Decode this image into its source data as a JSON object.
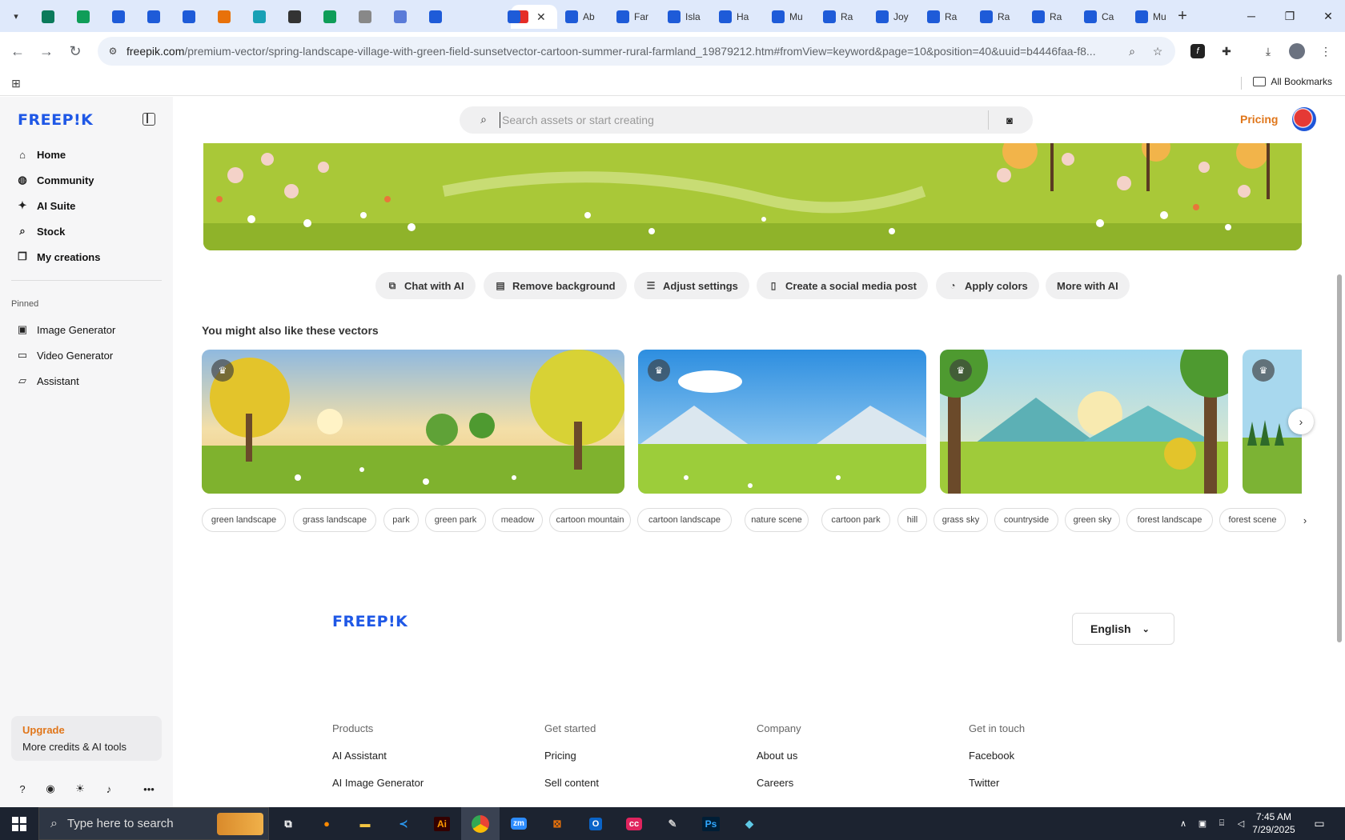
{
  "browser": {
    "tabs": [
      {
        "label": "",
        "color": "#0b7a5a"
      },
      {
        "label": "",
        "color": "#0f9d58"
      },
      {
        "label": "",
        "color": "#1e5bd8"
      },
      {
        "label": "",
        "color": "#1e5bd8"
      },
      {
        "label": "",
        "color": "#1e5bd8"
      },
      {
        "label": "",
        "color": "#e8710a"
      },
      {
        "label": "",
        "color": "#18a0b5"
      },
      {
        "label": "",
        "color": "#333333"
      },
      {
        "label": "",
        "color": "#0f9d58"
      },
      {
        "label": "",
        "color": "#888888"
      },
      {
        "label": "",
        "color": "#5a7bd8"
      },
      {
        "label": "",
        "color": "#1e5bd8"
      },
      {
        "label": "",
        "color": "#e52d27"
      },
      {
        "label": "",
        "color": "#1e5bd8"
      },
      {
        "label": "Ab",
        "color": "#1e5bd8"
      },
      {
        "label": "Far",
        "color": "#1e5bd8"
      },
      {
        "label": "Isla",
        "color": "#1e5bd8"
      },
      {
        "label": "Ha",
        "color": "#1e5bd8"
      },
      {
        "label": "Mu",
        "color": "#1e5bd8"
      },
      {
        "label": "Ra",
        "color": "#1e5bd8"
      },
      {
        "label": "Joy",
        "color": "#1e5bd8"
      },
      {
        "label": "Ra",
        "color": "#1e5bd8"
      },
      {
        "label": "Ra",
        "color": "#1e5bd8"
      },
      {
        "label": "Ra",
        "color": "#1e5bd8"
      },
      {
        "label": "Ca",
        "color": "#1e5bd8"
      },
      {
        "label": "Mu",
        "color": "#1e5bd8"
      }
    ],
    "url_host": "freepik.com",
    "url_path": "/premium-vector/spring-landscape-village-with-green-field-sunsetvector-cartoon-summer-rural-farmland_19879212.htm#fromView=keyword&page=10&position=40&uuid=b4446faa-f8...",
    "all_bookmarks": "All Bookmarks"
  },
  "sidebar": {
    "logo": "FREEP!K",
    "nav": [
      {
        "label": "Home",
        "icon": "home-icon",
        "glyph": "⌂"
      },
      {
        "label": "Community",
        "icon": "globe-icon",
        "glyph": "◍"
      },
      {
        "label": "AI Suite",
        "icon": "sparkle-icon",
        "glyph": "✦"
      },
      {
        "label": "Stock",
        "icon": "search-icon",
        "glyph": "⌕"
      },
      {
        "label": "My creations",
        "icon": "stack-icon",
        "glyph": "❐"
      }
    ],
    "pinned_label": "Pinned",
    "pinned": [
      {
        "label": "Image Generator",
        "icon": "image-icon",
        "glyph": "▣"
      },
      {
        "label": "Video Generator",
        "icon": "video-icon",
        "glyph": "▭"
      },
      {
        "label": "Assistant",
        "icon": "chat-icon",
        "glyph": "▱"
      }
    ],
    "upgrade_title": "Upgrade",
    "upgrade_sub": "More credits & AI tools"
  },
  "header": {
    "search_placeholder": "Search assets or start creating",
    "pricing": "Pricing"
  },
  "actions": [
    {
      "label": "Chat with AI",
      "icon": "chat-plus-icon",
      "glyph": "⧉"
    },
    {
      "label": "Remove background",
      "icon": "eraser-icon",
      "glyph": "▤"
    },
    {
      "label": "Adjust settings",
      "icon": "sliders-icon",
      "glyph": "☰"
    },
    {
      "label": "Create a social media post",
      "icon": "phone-icon",
      "glyph": "▯"
    },
    {
      "label": "Apply colors",
      "icon": "palette-icon",
      "glyph": "◔"
    },
    {
      "label": "More with AI",
      "icon": "",
      "glyph": ""
    }
  ],
  "similar_heading": "You might also like these vectors",
  "tags": [
    "green landscape",
    "grass landscape",
    "park",
    "green park",
    "meadow",
    "cartoon mountain",
    "cartoon landscape",
    "nature scene",
    "cartoon park",
    "hill",
    "grass sky",
    "countryside",
    "green sky",
    "forest landscape",
    "forest scene"
  ],
  "footer": {
    "logo": "FREEP!K",
    "language": "English",
    "columns": [
      {
        "heading": "Products",
        "links": [
          "AI Assistant",
          "AI Image Generator"
        ]
      },
      {
        "heading": "Get started",
        "links": [
          "Pricing",
          "Sell content"
        ]
      },
      {
        "heading": "Company",
        "links": [
          "About us",
          "Careers"
        ]
      },
      {
        "heading": "Get in touch",
        "links": [
          "Facebook",
          "Twitter"
        ]
      }
    ]
  },
  "taskbar": {
    "search_placeholder": "Type here to search",
    "time": "7:45 AM",
    "date": "7/29/2025"
  }
}
